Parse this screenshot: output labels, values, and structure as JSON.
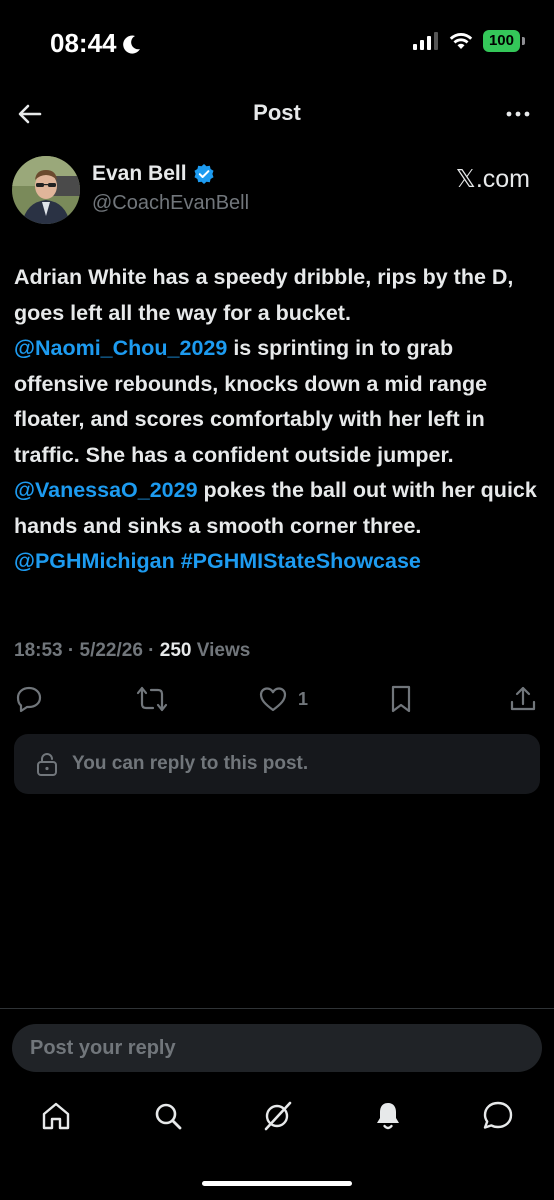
{
  "status_bar": {
    "time": "08:44",
    "battery": "100"
  },
  "header": {
    "title": "Post"
  },
  "post": {
    "author_name": "Evan Bell",
    "author_handle": "@CoachEvanBell",
    "source": "𝕏.com",
    "body": {
      "t1": "Adrian White has a speedy dribble, rips by the D, goes left all the way for a bucket. ",
      "m1": "@Naomi_Chou_2029",
      "t2": " is sprinting in to grab offensive rebounds, knocks down a mid range floater, and scores comfortably with her left in traffic. She has a confident outside jumper. ",
      "m2": "@VanessaO_2029",
      "t3": " pokes the ball out with her quick hands and sinks a smooth corner three. ",
      "m3": "@PGHMichigan",
      "h1": "#PGHMIStateShowcase"
    },
    "time": "18:53",
    "date": "5/22/26",
    "views_count": "250",
    "views_label": "Views",
    "likes": "1"
  },
  "reply_notice": "You can reply to this post.",
  "reply_input": {
    "placeholder": "Post your reply"
  },
  "colors": {
    "background": "#000000",
    "link": "#1d9bf0",
    "muted": "#71767b",
    "verified": "#1d9bf0"
  }
}
